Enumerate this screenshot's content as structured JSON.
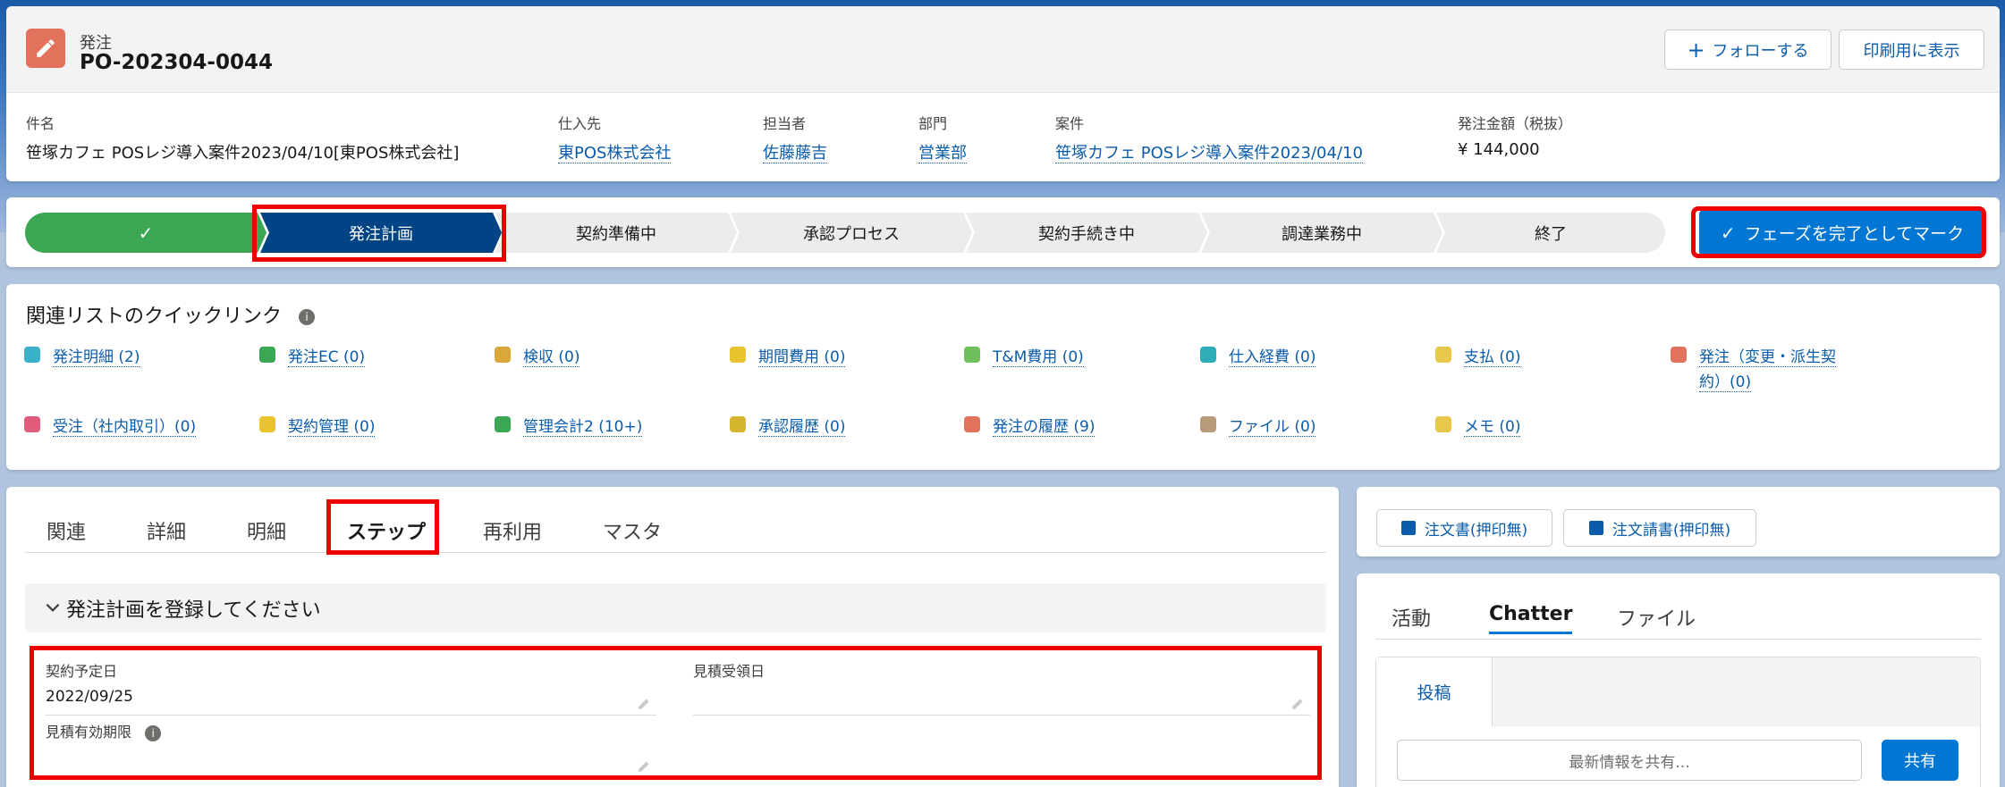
{
  "record": {
    "type_label": "発注",
    "title": "PO-202304-0044",
    "follow_label": "フォローする",
    "print_label": "印刷用に表示"
  },
  "header_fields": [
    {
      "label": "件名",
      "value": "笹塚カフェ POSレジ導入案件2023/04/10[東POS株式会社]"
    },
    {
      "label": "仕入先",
      "value": "東POS株式会社"
    },
    {
      "label": "担当者",
      "value": "佐藤藤吉"
    },
    {
      "label": "部門",
      "value": "営業部"
    },
    {
      "label": "案件",
      "value": "笹塚カフェ POSレジ導入案件2023/04/10"
    },
    {
      "label": "発注金額（税抜）",
      "value": "¥ 144,000"
    }
  ],
  "path": {
    "steps": [
      "発注計画",
      "契約準備中",
      "承認プロセス",
      "契約手続き中",
      "調達業務中",
      "終了"
    ],
    "complete_step_symbol": "✓",
    "mark_complete_label": "フェーズを完了としてマーク"
  },
  "quick_links": {
    "title": "関連リストのクイックリンク",
    "items": [
      {
        "label": "発注明細 (2)",
        "color": "#3bb1c9"
      },
      {
        "label": "発注EC (0)",
        "color": "#3ba755"
      },
      {
        "label": "検収 (0)",
        "color": "#d9a73a"
      },
      {
        "label": "期間費用 (0)",
        "color": "#e8c32e"
      },
      {
        "label": "T&M費用 (0)",
        "color": "#6fbf5d"
      },
      {
        "label": "仕入経費 (0)",
        "color": "#2eadb8"
      },
      {
        "label": "支払 (0)",
        "color": "#e8c84a"
      },
      {
        "label": "発注（変更・派生契",
        "label2": "約）(0)",
        "color": "#e3725c"
      },
      {
        "label": "受注（社内取引）(0)",
        "color": "#e05c7b"
      },
      {
        "label": "契約管理 (0)",
        "color": "#e8c32e"
      },
      {
        "label": "管理会計2 (10+)",
        "color": "#3ba755"
      },
      {
        "label": "承認履歴 (0)",
        "color": "#d6b62e"
      },
      {
        "label": "発注の履歴 (9)",
        "color": "#e3725c"
      },
      {
        "label": "ファイル (0)",
        "color": "#b69a7a"
      },
      {
        "label": "メモ (0)",
        "color": "#e8c84a"
      }
    ]
  },
  "main_tabs": [
    "関連",
    "詳細",
    "明細",
    "ステップ",
    "再利用",
    "マスタ"
  ],
  "section": {
    "title": "発注計画を登録してください",
    "fields": [
      {
        "label": "契約予定日",
        "value": "2022/09/25"
      },
      {
        "label": "見積受領日",
        "value": ""
      },
      {
        "label": "見積有効期限",
        "value": ""
      }
    ]
  },
  "doc_buttons": [
    "注文書(押印無)",
    "注文請書(押印無)"
  ],
  "activity_tabs": [
    "活動",
    "Chatter",
    "ファイル"
  ],
  "publisher": {
    "tab_label": "投稿",
    "placeholder": "最新情報を共有...",
    "share_label": "共有"
  }
}
